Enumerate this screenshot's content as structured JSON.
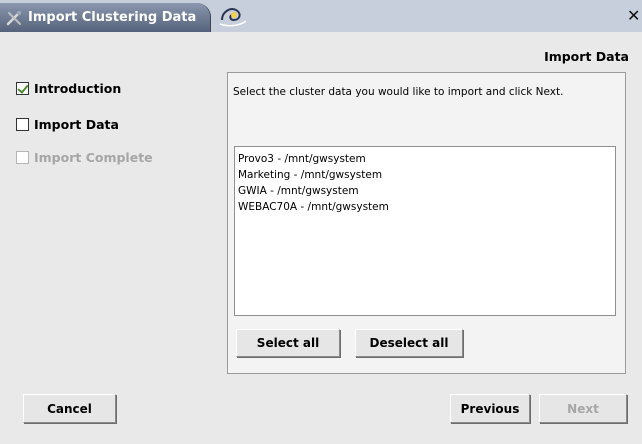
{
  "window": {
    "title": "Import Clustering Data"
  },
  "header": {
    "page_title": "Import Data"
  },
  "steps": [
    {
      "label": "Introduction",
      "checked": true,
      "enabled": true
    },
    {
      "label": "Import Data",
      "checked": false,
      "enabled": true
    },
    {
      "label": "Import Complete",
      "checked": false,
      "enabled": false
    }
  ],
  "main": {
    "instructions": "Select the cluster data you would like to import and click Next.",
    "clusters": [
      "Provo3 - /mnt/gwsystem",
      "Marketing - /mnt/gwsystem",
      "GWIA - /mnt/gwsystem",
      "WEBAC70A - /mnt/gwsystem"
    ],
    "select_all_label": "Select all",
    "deselect_all_label": "Deselect all"
  },
  "footer": {
    "cancel_label": "Cancel",
    "previous_label": "Previous",
    "next_label": "Next"
  },
  "colors": {
    "titlebar_bg": "#c7cfdc",
    "active_tab": "#55627b",
    "background": "#e9e9e9",
    "check_green": "#4a8a2a",
    "disabled_text": "#a6a6a6"
  }
}
